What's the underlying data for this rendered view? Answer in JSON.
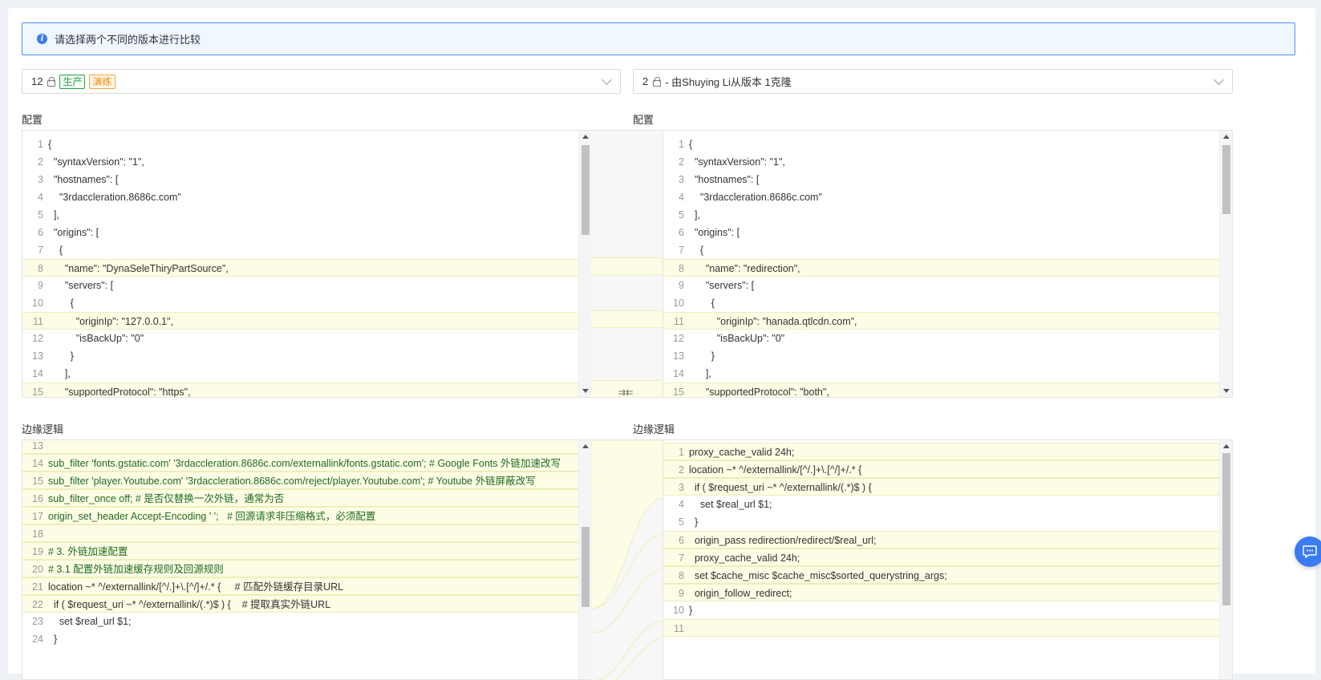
{
  "alert": {
    "text": "请选择两个不同的版本进行比较"
  },
  "left_select": {
    "version": "12",
    "tags": [
      "生产",
      "演练"
    ]
  },
  "right_select": {
    "version": "2",
    "description": "- 由Shuying Li从版本 1克隆"
  },
  "config_label_left": "配置",
  "config_label_right": "配置",
  "edge_label_left": "边缘逻辑",
  "edge_label_right": "边缘逻辑",
  "merge_icon_text": "⇉⇇",
  "config_left": [
    {
      "n": "1",
      "t": "{"
    },
    {
      "n": "2",
      "t": "  \"syntaxVersion\": \"1\","
    },
    {
      "n": "3",
      "t": "  \"hostnames\": ["
    },
    {
      "n": "4",
      "t": "    \"3rdaccleration.8686c.com\""
    },
    {
      "n": "5",
      "t": "  ],"
    },
    {
      "n": "6",
      "t": "  \"origins\": ["
    },
    {
      "n": "7",
      "t": "    {"
    },
    {
      "n": "8",
      "t": "      \"name\": \"DynaSeleThiryPartSource\","
    },
    {
      "n": "9",
      "t": "      \"servers\": ["
    },
    {
      "n": "10",
      "t": "        {"
    },
    {
      "n": "11",
      "t": "          \"originIp\": \"127.0.0.1\","
    },
    {
      "n": "12",
      "t": "          \"isBackUp\": \"0\""
    },
    {
      "n": "13",
      "t": "        }"
    },
    {
      "n": "14",
      "t": "      ],"
    },
    {
      "n": "15",
      "t": "      \"supportedProtocol\": \"https\","
    }
  ],
  "config_right": [
    {
      "n": "1",
      "t": "{"
    },
    {
      "n": "2",
      "t": "  \"syntaxVersion\": \"1\","
    },
    {
      "n": "3",
      "t": "  \"hostnames\": ["
    },
    {
      "n": "4",
      "t": "    \"3rdaccleration.8686c.com\""
    },
    {
      "n": "5",
      "t": "  ],"
    },
    {
      "n": "6",
      "t": "  \"origins\": ["
    },
    {
      "n": "7",
      "t": "    {"
    },
    {
      "n": "8",
      "t": "      \"name\": \"redirection\","
    },
    {
      "n": "9",
      "t": "      \"servers\": ["
    },
    {
      "n": "10",
      "t": "        {"
    },
    {
      "n": "11",
      "t": "          \"originIp\": \"hanada.qtlcdn.com\","
    },
    {
      "n": "12",
      "t": "          \"isBackUp\": \"0\""
    },
    {
      "n": "13",
      "t": "        }"
    },
    {
      "n": "14",
      "t": "      ],"
    },
    {
      "n": "15",
      "t": "      \"supportedProtocol\": \"both\","
    }
  ],
  "edge_left": [
    {
      "n": "13",
      "t": ""
    },
    {
      "n": "14",
      "t": "sub_filter 'fonts.gstatic.com' '3rdaccleration.8686c.com/externallink/fonts.gstatic.com'; # Google Fonts 外链加速改写"
    },
    {
      "n": "15",
      "t": "sub_filter 'player.Youtube.com' '3rdaccleration.8686c.com/reject/player.Youtube.com'; # Youtube 外链屏蔽改写"
    },
    {
      "n": "16",
      "t": "sub_filter_once off; # 是否仅替换一次外链，通常为否"
    },
    {
      "n": "17",
      "t": "origin_set_header Accept-Encoding ' ';   # 回源请求非压缩格式，必须配置"
    },
    {
      "n": "18",
      "t": ""
    },
    {
      "n": "19",
      "t": "# 3. 外链加速配置"
    },
    {
      "n": "20",
      "t": "# 3.1 配置外链加速缓存规则及回源规则"
    },
    {
      "n": "21",
      "t": "location ~* ^/externallink/[^/.]+\\.[^/]+/.* {     # 匹配外链缓存目录URL"
    },
    {
      "n": "22",
      "t": "  if ( $request_uri ~* ^/externallink/(.*)$ ) {    # 提取真实外链URL"
    },
    {
      "n": "23",
      "t": "    set $real_url $1;"
    },
    {
      "n": "24",
      "t": "  }"
    }
  ],
  "edge_right": [
    {
      "n": "1",
      "t": "proxy_cache_valid 24h;"
    },
    {
      "n": "2",
      "t": "location ~* ^/externallink/[^/.]+\\.[^/]+/.* {"
    },
    {
      "n": "3",
      "t": "  if ( $request_uri ~* ^/externallink/(.*)$ ) {"
    },
    {
      "n": "4",
      "t": "    set $real_url $1;"
    },
    {
      "n": "5",
      "t": "  }"
    },
    {
      "n": "6",
      "t": "  origin_pass redirection/redirect/$real_url;"
    },
    {
      "n": "7",
      "t": "  proxy_cache_valid 24h;"
    },
    {
      "n": "8",
      "t": "  set $cache_misc $cache_misc$sorted_querystring_args;"
    },
    {
      "n": "9",
      "t": "  origin_follow_redirect;"
    },
    {
      "n": "10",
      "t": "}"
    },
    {
      "n": "11",
      "t": ""
    }
  ]
}
